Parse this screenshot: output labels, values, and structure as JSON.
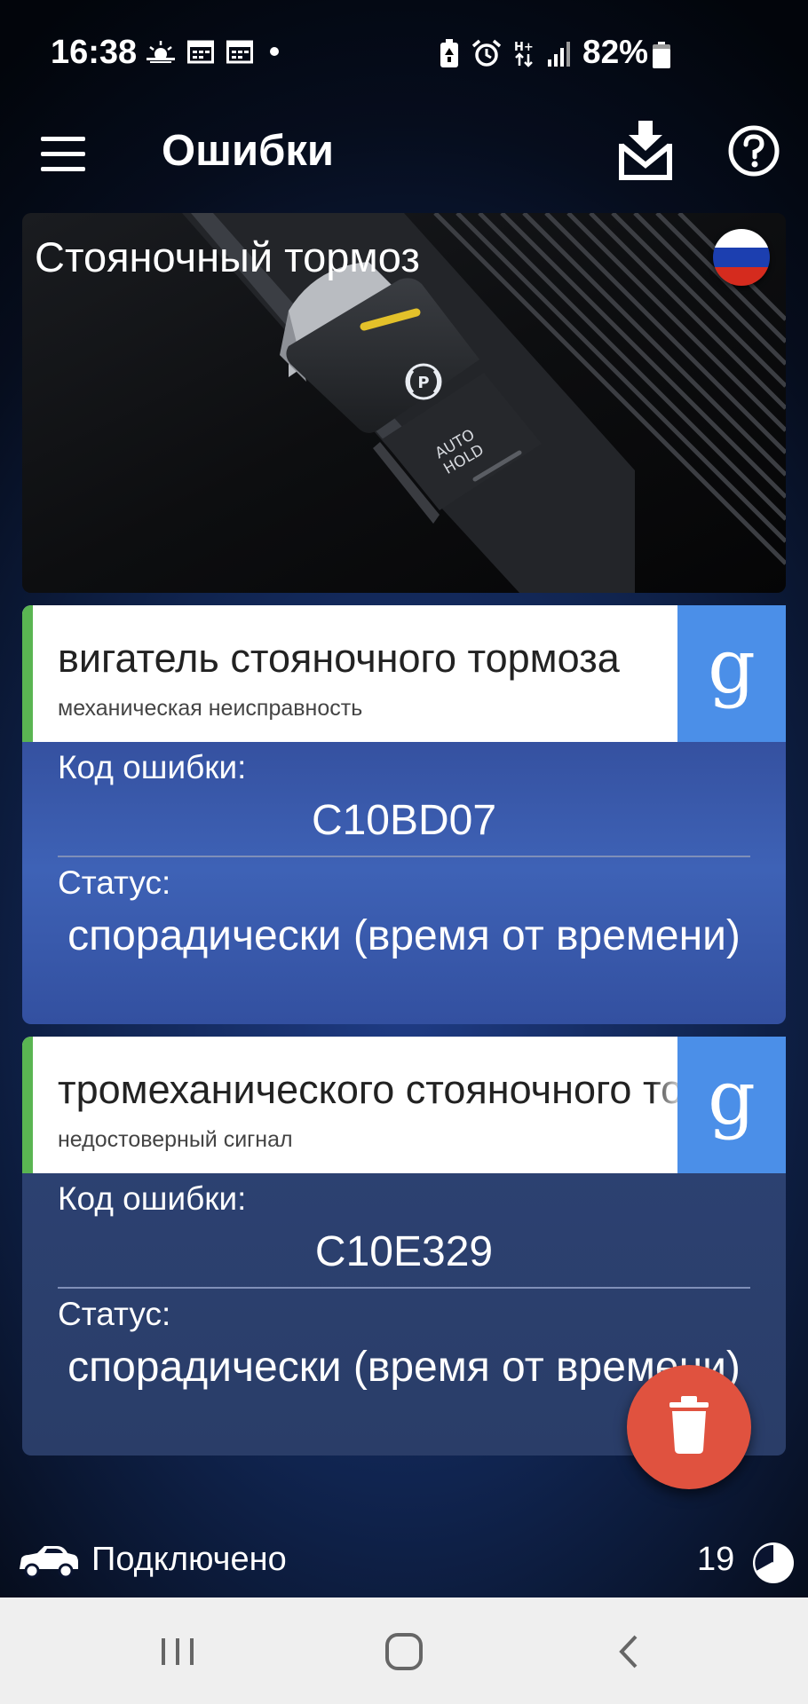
{
  "status_bar": {
    "time": "16:38",
    "battery_percent": "82%",
    "icons_left": [
      "weather-icon",
      "calendar-icon",
      "calendar-icon",
      "dot-icon"
    ],
    "icons_right": [
      "battery-saver-icon",
      "alarm-icon",
      "hplus-data-icon",
      "signal-icon",
      "battery-icon"
    ]
  },
  "app_bar": {
    "title": "Ошибки",
    "icons": [
      "menu-icon",
      "download-icon",
      "help-icon"
    ]
  },
  "hero": {
    "title": "Стояночный тормоз",
    "flag": "russia",
    "flag_colors": [
      "#ffffff",
      "#1c3fb0",
      "#d52b1e"
    ],
    "button_label": "AUTO\nHOLD",
    "auto_hold_line1": "AUTO",
    "auto_hold_line2": "HOLD",
    "park_symbol": "P"
  },
  "errors": [
    {
      "name": "вигатель стояночного тормоза",
      "description": "механическая неисправность",
      "code_label": "Код ошибки:",
      "code": "C10BD07",
      "status_label": "Статус:",
      "status": "спорадически (время от времени)",
      "google_label": "g"
    },
    {
      "name": "тромеханического стояночного тормоза",
      "description": "недостоверный сигнал",
      "code_label": "Код ошибки:",
      "code": "C10E329",
      "status_label": "Статус:",
      "status": "спорадически (время от времени)",
      "google_label": "g"
    }
  ],
  "bottom": {
    "connection_status": "Подключено",
    "count": "19"
  },
  "colors": {
    "accent_green": "#5ab552",
    "google_blue": "#4b8fe8",
    "delete_red": "#e0523f",
    "card_body_1": "#3a5aa6",
    "card_body_2": "#2c4170"
  }
}
